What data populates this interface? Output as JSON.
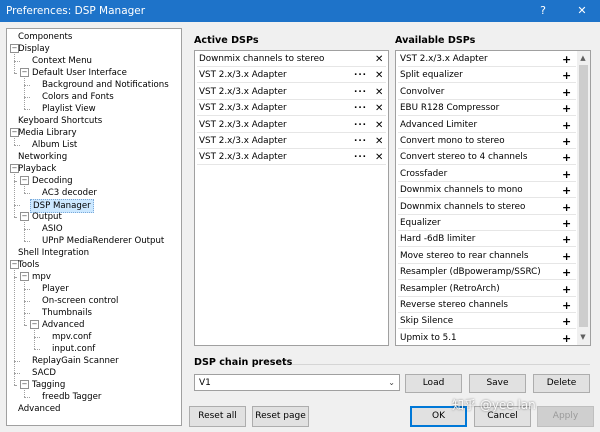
{
  "window": {
    "title": "Preferences: DSP Manager",
    "help_glyph": "?",
    "close_glyph": "✕"
  },
  "tree": [
    {
      "label": "Components",
      "level": 0
    },
    {
      "label": "Display",
      "level": 0,
      "expander": "−"
    },
    {
      "label": "Context Menu",
      "level": 1
    },
    {
      "label": "Default User Interface",
      "level": 1,
      "expander": "−"
    },
    {
      "label": "Background and Notifications",
      "level": 2
    },
    {
      "label": "Colors and Fonts",
      "level": 2
    },
    {
      "label": "Playlist View",
      "level": 2
    },
    {
      "label": "Keyboard Shortcuts",
      "level": 0
    },
    {
      "label": "Media Library",
      "level": 0,
      "expander": "−"
    },
    {
      "label": "Album List",
      "level": 1
    },
    {
      "label": "Networking",
      "level": 0
    },
    {
      "label": "Playback",
      "level": 0,
      "expander": "−"
    },
    {
      "label": "Decoding",
      "level": 1,
      "expander": "−"
    },
    {
      "label": "AC3 decoder",
      "level": 2
    },
    {
      "label": "DSP Manager",
      "level": 1,
      "selected": true
    },
    {
      "label": "Output",
      "level": 1,
      "expander": "−"
    },
    {
      "label": "ASIO",
      "level": 2
    },
    {
      "label": "UPnP MediaRenderer Output",
      "level": 2
    },
    {
      "label": "Shell Integration",
      "level": 0
    },
    {
      "label": "Tools",
      "level": 0,
      "expander": "−"
    },
    {
      "label": "mpv",
      "level": 1,
      "expander": "−"
    },
    {
      "label": "Player",
      "level": 2
    },
    {
      "label": "On-screen control",
      "level": 2
    },
    {
      "label": "Thumbnails",
      "level": 2
    },
    {
      "label": "Advanced",
      "level": 2,
      "expander": "−"
    },
    {
      "label": "mpv.conf",
      "level": 3
    },
    {
      "label": "input.conf",
      "level": 3
    },
    {
      "label": "ReplayGain Scanner",
      "level": 1
    },
    {
      "label": "SACD",
      "level": 1
    },
    {
      "label": "Tagging",
      "level": 1,
      "expander": "−"
    },
    {
      "label": "freedb Tagger",
      "level": 2
    },
    {
      "label": "Advanced",
      "level": 0
    }
  ],
  "active": {
    "title": "Active DSPs",
    "items": [
      {
        "name": "Downmix channels to stereo",
        "configurable": false
      },
      {
        "name": "VST 2.x/3.x Adapter",
        "configurable": true
      },
      {
        "name": "VST 2.x/3.x Adapter",
        "configurable": true
      },
      {
        "name": "VST 2.x/3.x Adapter",
        "configurable": true
      },
      {
        "name": "VST 2.x/3.x Adapter",
        "configurable": true
      },
      {
        "name": "VST 2.x/3.x Adapter",
        "configurable": true
      },
      {
        "name": "VST 2.x/3.x Adapter",
        "configurable": true
      }
    ],
    "config_glyph": "...",
    "remove_glyph": "✕"
  },
  "available": {
    "title": "Available DSPs",
    "items": [
      "VST 2.x/3.x Adapter",
      "Split equalizer",
      "Convolver",
      "EBU R128 Compressor",
      "Advanced Limiter",
      "Convert mono to stereo",
      "Convert stereo to 4 channels",
      "Crossfader",
      "Downmix channels to mono",
      "Downmix channels to stereo",
      "Equalizer",
      "Hard -6dB limiter",
      "Move stereo to rear channels",
      "Resampler (dBpoweramp/SSRC)",
      "Resampler (RetroArch)",
      "Reverse stereo channels",
      "Skip Silence",
      "Upmix to 5.1"
    ],
    "add_glyph": "+",
    "scroll_up_glyph": "▲",
    "scroll_down_glyph": "▼"
  },
  "presets": {
    "title": "DSP chain presets",
    "value": "V1",
    "dropdown_glyph": "⌄",
    "load_label": "Load",
    "save_label": "Save",
    "delete_label": "Delete"
  },
  "footer": {
    "reset_all_label": "Reset all",
    "reset_page_label": "Reset page",
    "ok_label": "OK",
    "cancel_label": "Cancel",
    "apply_label": "Apply"
  },
  "watermark": "知乎 @yee lan"
}
